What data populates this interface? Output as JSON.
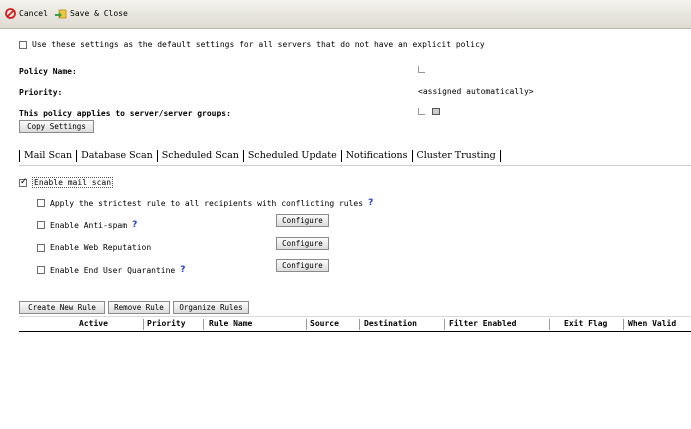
{
  "toolbar": {
    "cancel_label": "Cancel",
    "save_close_label": "Save & Close"
  },
  "default_settings": {
    "checked": false,
    "label": "Use these settings as the default settings for all servers that do not have an explicit policy"
  },
  "fields": {
    "policy_name_label": "Policy Name:",
    "priority_label": "Priority:",
    "priority_value": "<assigned automatically>",
    "applies_label": "This policy applies to server/server groups:"
  },
  "copy_settings_label": "Copy Settings",
  "tabs": [
    "Mail Scan",
    "Database Scan",
    "Scheduled Scan",
    "Scheduled Update",
    "Notifications",
    "Cluster Trusting"
  ],
  "mail_scan": {
    "enable_label": "Enable mail scan",
    "strictest_label": "Apply the strictest rule to all recipients with conflicting rules",
    "antispam_label": "Enable Anti-spam",
    "web_rep_label": "Enable Web Reputation",
    "quarantine_label": "Enable End User Quarantine",
    "configure_label": "Configure",
    "help_glyph": "?"
  },
  "rule_buttons": {
    "create": "Create New Rule",
    "remove": "Remove Rule",
    "organize": "Organize Rules"
  },
  "table_headers": [
    "Active",
    "Priority",
    "Rule Name",
    "Source",
    "Destination",
    "Filter Enabled",
    "Exit Flag",
    "When Valid"
  ]
}
